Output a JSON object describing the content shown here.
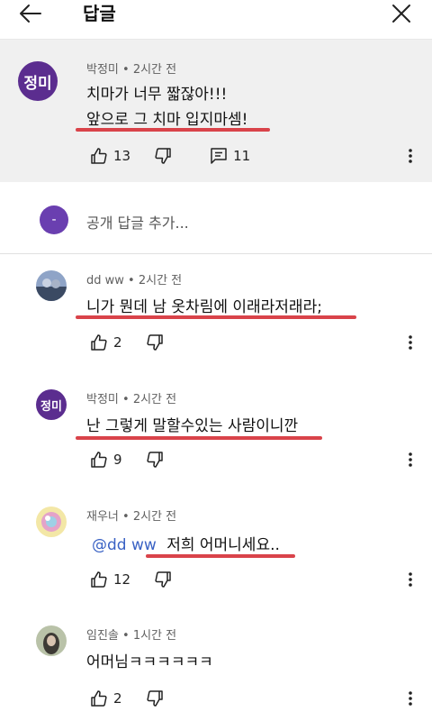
{
  "header": {
    "title": "답글"
  },
  "top_comment": {
    "avatar_text": "정미",
    "meta": "박정미 • 2시간 전",
    "line1": "치마가 너무 짧잖아!!!",
    "line2": "앞으로 그 치마 입지마셈!",
    "likes": "13",
    "replies": "11"
  },
  "add_reply": {
    "avatar_text": "-",
    "placeholder": "공개 답글 추가..."
  },
  "replies": [
    {
      "meta": "dd ww • 2시간 전",
      "text": "니가 뭔데 남 옷차림에 이래라저래라;",
      "likes": "2"
    },
    {
      "avatar_text": "정미",
      "meta": "박정미 • 2시간 전",
      "text": "난 그렇게 말할수있는 사람이니깐",
      "likes": "9"
    },
    {
      "meta": "재우너 • 2시간 전",
      "mention": "@dd ww",
      "text": "저희 어머니세요..",
      "likes": "12"
    },
    {
      "meta": "임진솔 • 1시간 전",
      "text": "어머님ㅋㅋㅋㅋㅋㅋ",
      "likes": "2"
    }
  ],
  "colors": {
    "underline": "#d9434a",
    "avatar_purple": "#5b2d8f",
    "mention": "#3a62c4"
  }
}
